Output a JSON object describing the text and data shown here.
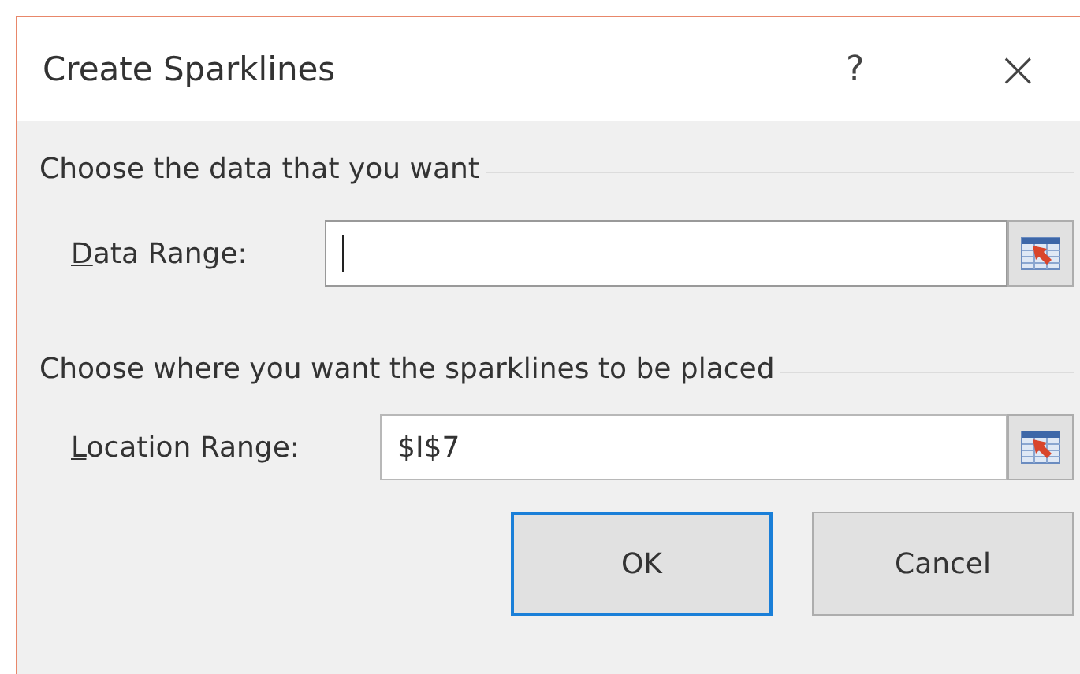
{
  "window": {
    "title": "Create Sparklines",
    "help": "?",
    "close": "×"
  },
  "sections": [
    {
      "heading": "Choose the data that you want",
      "field": {
        "label": "Data Range:",
        "focused": true,
        "kind": "data"
      }
    },
    {
      "heading": "Choose where you want the sparklines to be placed",
      "field": {
        "label": "Location Range:",
        "value": "$I$7",
        "focused": false,
        "kind": "location"
      }
    }
  ],
  "buttons": [
    {
      "label": "OK",
      "default": true
    },
    {
      "label": "Cancel",
      "default": false
    }
  ]
}
